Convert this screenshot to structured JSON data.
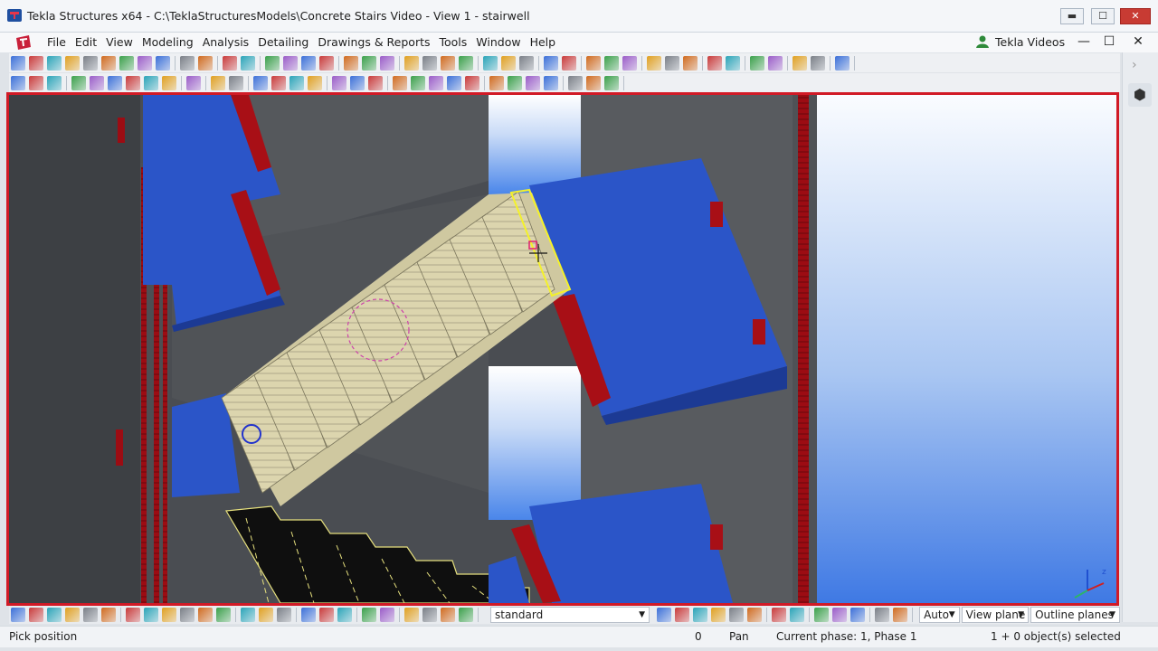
{
  "window": {
    "title": "Tekla Structures x64 - C:\\TeklaStructuresModels\\Concrete Stairs Video  - View 1 - stairwell",
    "minimize_label": "▬",
    "maximize_label": "☐",
    "close_label": "✕"
  },
  "menu": {
    "items": [
      "File",
      "Edit",
      "View",
      "Modeling",
      "Analysis",
      "Detailing",
      "Drawings & Reports",
      "Tools",
      "Window",
      "Help"
    ],
    "account_label": "Tekla Videos",
    "mdi_minimize": "—",
    "mdi_restore": "☐",
    "mdi_close": "✕"
  },
  "side_panel": {
    "chevron": "›",
    "cube_icon": "⬢"
  },
  "selection_bar": {
    "filter_value": "standard",
    "snap_depth": "Auto",
    "work_plane": "View plane",
    "snap_planes": "Outline planes"
  },
  "status": {
    "prompt": "Pick position",
    "counter": "0",
    "mode": "Pan",
    "phase": "Current phase: 1, Phase 1",
    "selection": "1 + 0 object(s) selected"
  },
  "colors": {
    "selection_border": "#d11a26",
    "slab_blue": "#2b55c8",
    "rebar_red": "#a80f16",
    "stair_beige": "#d9d2aa",
    "sky_blue": "#4a86ea"
  },
  "icons": [
    "app-icon",
    "tekla-logo-icon",
    "user-icon",
    "cube-icon",
    "axis-icon"
  ]
}
